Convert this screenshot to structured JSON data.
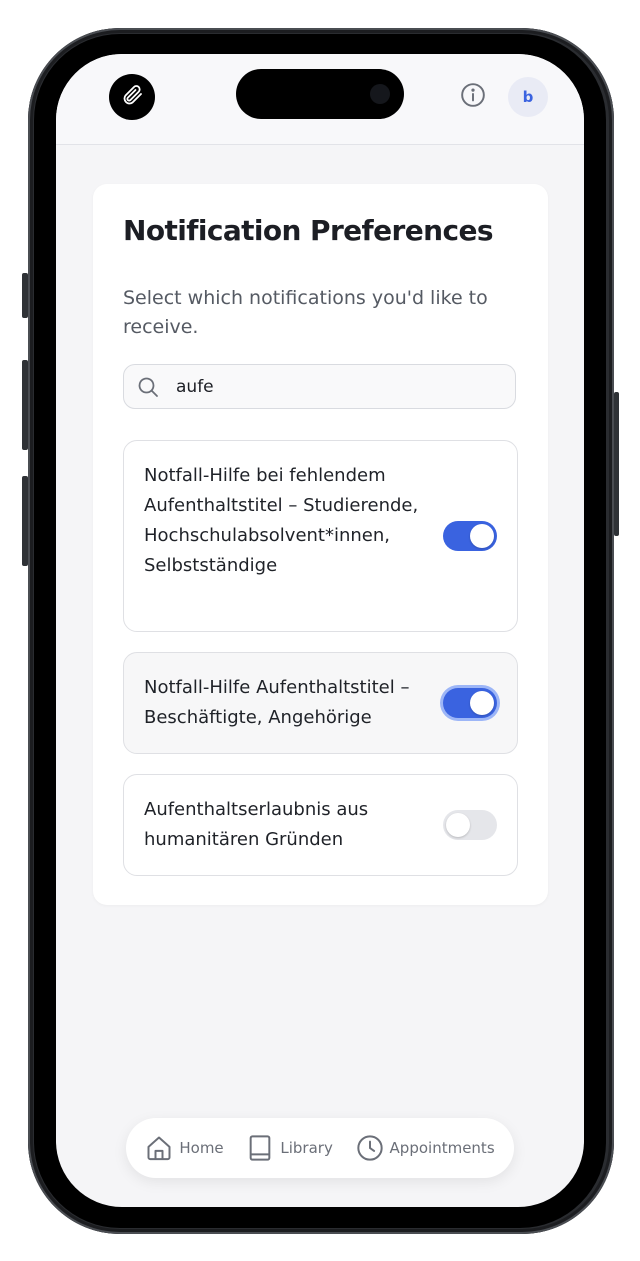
{
  "header": {
    "logo_icon": "paperclip-icon",
    "info_icon": "info-icon",
    "avatar_initial": "b"
  },
  "page": {
    "title": "Notification Preferences",
    "subtitle": "Select which notifications you'd like to receive."
  },
  "search": {
    "value": "aufe",
    "icon": "search-icon"
  },
  "preferences": [
    {
      "label": "Notfall-Hilfe bei fehlendem Aufenthaltstitel – Studierende, Hochschulabsolvent*innen, Selbstständige",
      "enabled": true
    },
    {
      "label": "Notfall-Hilfe Aufenthaltstitel – Beschäftigte, Angehörige",
      "enabled": true,
      "focused": true
    },
    {
      "label": "Aufenthaltserlaubnis aus humanitären Gründen",
      "enabled": false
    }
  ],
  "nav": {
    "items": [
      {
        "label": "Home",
        "icon": "home-icon"
      },
      {
        "label": "Library",
        "icon": "book-icon"
      },
      {
        "label": "Appointments",
        "icon": "clock-icon"
      }
    ]
  },
  "colors": {
    "accent": "#3a63e0",
    "toggle_off": "#e5e6ea"
  }
}
